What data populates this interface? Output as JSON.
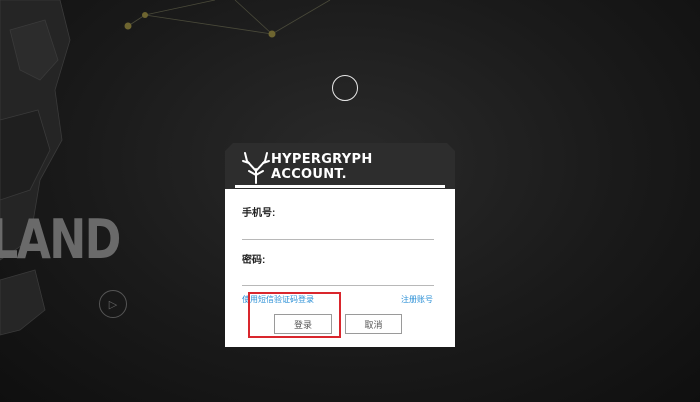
{
  "background": {
    "brand_text": "LAND",
    "play_icon": "play-icon"
  },
  "dialog": {
    "brand_title": "HYPERGRYPH\nACCOUNT.",
    "logo_icon": "hypergryph-antler-logo",
    "phone_label": "手机号:",
    "phone_value": "",
    "password_label": "密码:",
    "password_value": "",
    "sms_login_link": "使用短信验证码登录",
    "register_link": "注册账号",
    "login_button": "登录",
    "cancel_button": "取消"
  },
  "colors": {
    "background": "#1a1a1a",
    "header": "#2d2d2d",
    "link": "#2a8fd6",
    "highlight": "#d9262d"
  }
}
